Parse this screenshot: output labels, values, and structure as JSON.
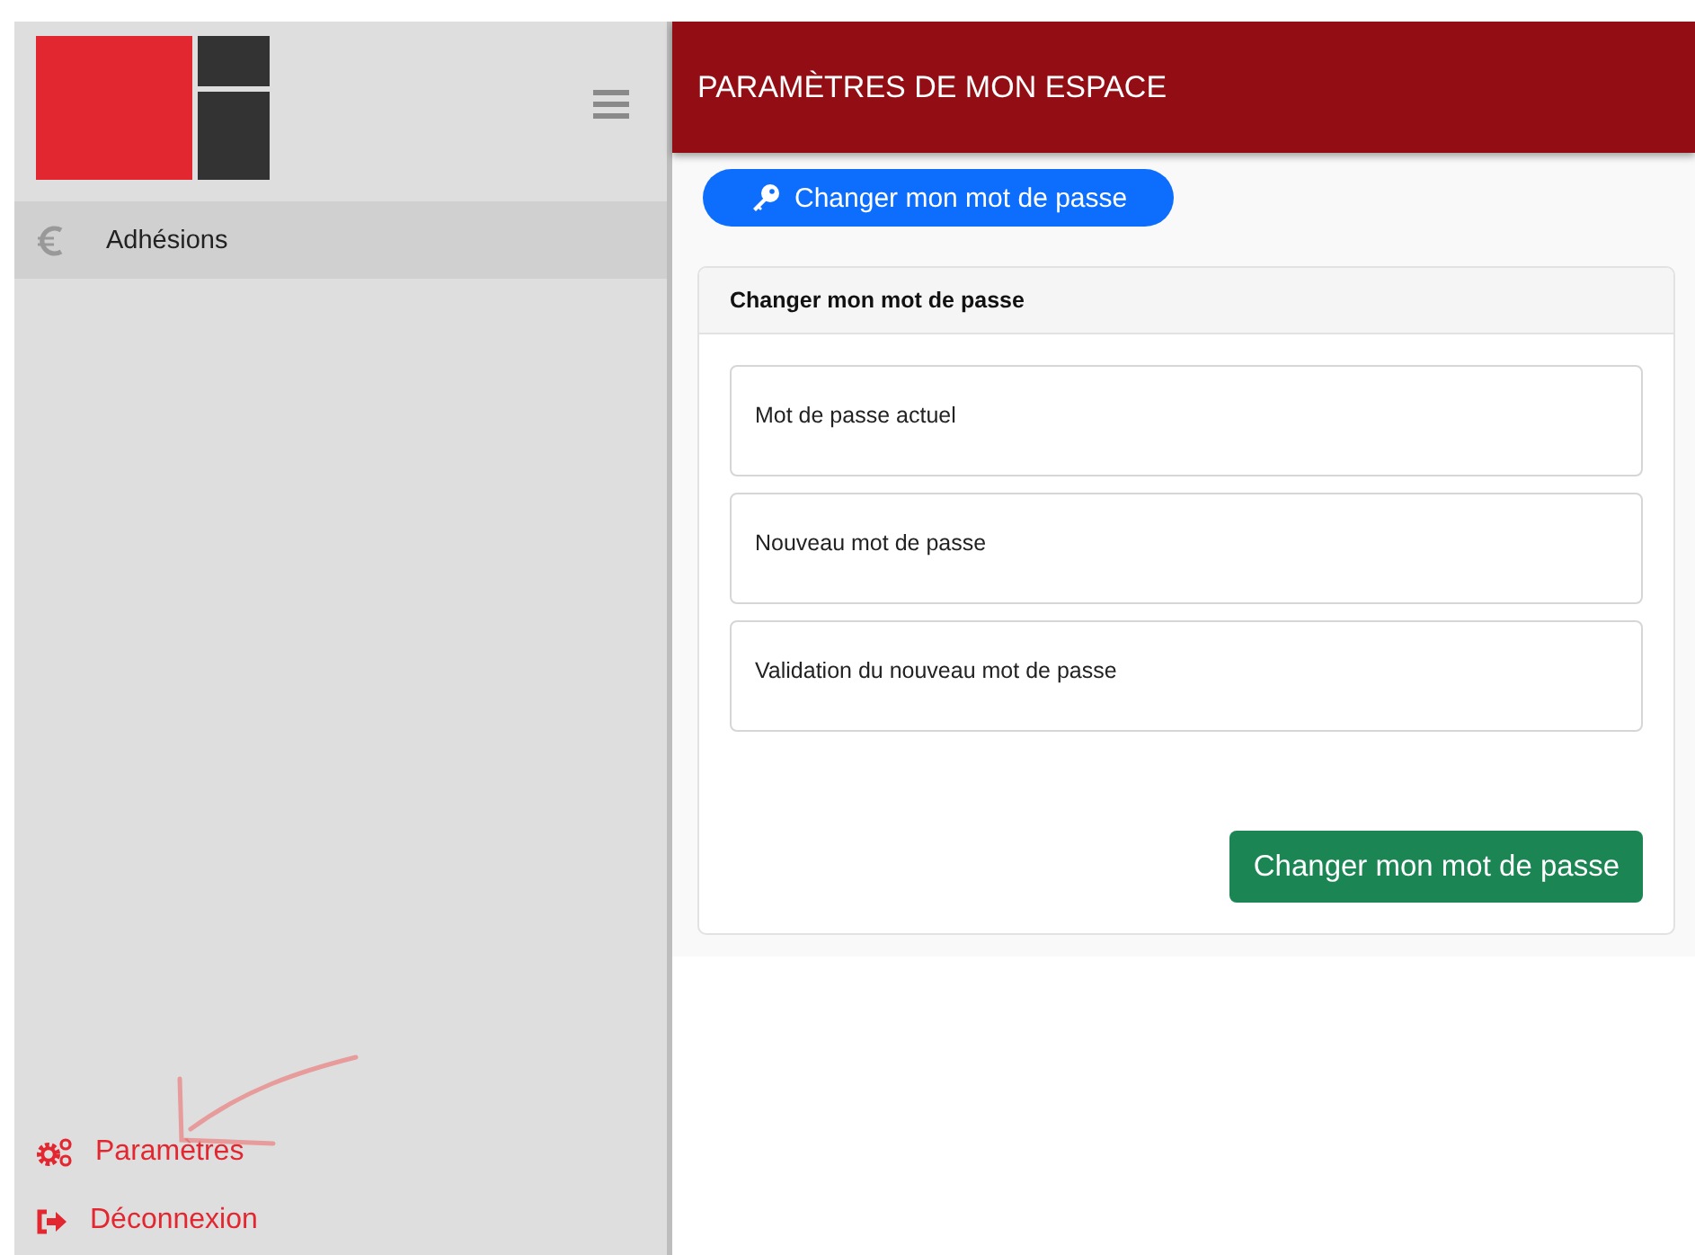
{
  "sidebar": {
    "items": [
      {
        "label": "Adhésions",
        "selected": true,
        "kind": "euro"
      }
    ],
    "footer_links": [
      {
        "label": "Paramètres",
        "kind": "gears"
      },
      {
        "label": "Déconnexion",
        "kind": "logout"
      }
    ]
  },
  "header": {
    "title": "PARAMÈTRES DE MON ESPACE"
  },
  "tab_button": {
    "label": "Changer mon mot de passe"
  },
  "panel": {
    "title": "Changer mon mot de passe",
    "fields": [
      {
        "placeholder": "Mot de passe actuel"
      },
      {
        "placeholder": "Nouveau mot de passe"
      },
      {
        "placeholder": "Validation du nouveau mot de passe"
      }
    ],
    "submit": "Changer mon mot de passe"
  }
}
